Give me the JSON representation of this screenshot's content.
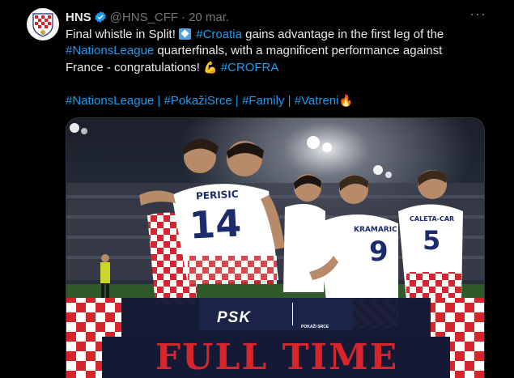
{
  "author": {
    "name": "HNS",
    "handle": "@HNS_CFF",
    "separator": "·",
    "date": "20 mar."
  },
  "menu": {
    "more_label": "···"
  },
  "tweet": {
    "line1_a": "Final whistle in Split! ",
    "line1_tag": "#Croatia",
    "line1_b": " gains advantage in the first leg of the",
    "line2_tag": "#NationsLeague",
    "line2_b": " quarterfinals, with a magnificent performance against",
    "line3_a": "France - congratulations! ",
    "line3_tag": "#CROFRA",
    "hashtags": {
      "t1": "#NationsLeague",
      "sep1": " | ",
      "t2": "#PokažiSrce",
      "sep2": " | ",
      "t3": "#Family",
      "sep3": " | ",
      "t4": "#Vatreni"
    },
    "emoji_flex": "💪",
    "emoji_fire": "🔥"
  },
  "media": {
    "sponsor_name": "PSK",
    "sponsor_tagline": "POKAŽI SRCE",
    "banner": "FULL TIME",
    "players": [
      {
        "name": "PERISIC",
        "number": "14"
      },
      {
        "name": "KRAMARIC",
        "number": "9"
      },
      {
        "name": "CALETA-CAR",
        "number": "5"
      }
    ]
  },
  "colors": {
    "background": "#000000",
    "text": "#e7e9ea",
    "muted": "#71767b",
    "link": "#1d9bf0",
    "verified": "#1d9bf0",
    "croatia_red": "#d6262b",
    "navy": "#1b2347"
  },
  "icons": {
    "verified": "verified-badge-icon",
    "more": "more-options-icon",
    "avatar": "hns-crest-logo"
  }
}
